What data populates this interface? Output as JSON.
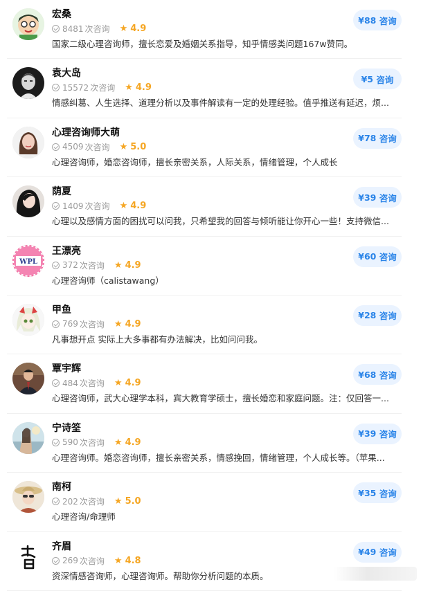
{
  "consult_label": "咨询",
  "count_unit": "次咨询",
  "experts": [
    {
      "name": "宏桑",
      "count": "8481",
      "rating": "4.9",
      "desc": "国家二级心理咨询师，擅长恋爱及婚姻关系指导，知乎情感类问题167w赞同。",
      "price": "¥88",
      "avatar": "cartoon-boy-avatar"
    },
    {
      "name": "袁大岛",
      "count": "15572",
      "rating": "4.9",
      "desc": "情感纠葛、人生选择、道理分析以及事件解读有一定的处理经验。值乎推送有延迟，烦...",
      "price": "¥5",
      "avatar": "portrait-man-avatar"
    },
    {
      "name": "心理咨询师大萌",
      "count": "4509",
      "rating": "5.0",
      "desc": "心理咨询师，婚恋咨询师，擅长亲密关系，人际关系，情绪管理，个人成长",
      "price": "¥78",
      "avatar": "woman-photo-avatar"
    },
    {
      "name": "荫夏",
      "count": "1409",
      "rating": "4.9",
      "desc": "心理以及感情方面的困扰可以问我，只希望我的回答与倾听能让你开心一些！支持微信...",
      "price": "¥39",
      "avatar": "woman-dark-hair-avatar"
    },
    {
      "name": "王漂亮",
      "count": "372",
      "rating": "4.9",
      "desc": "心理咨询师（calistawang）",
      "price": "¥60",
      "avatar": "wpl-logo-avatar"
    },
    {
      "name": "甲鱼",
      "count": "769",
      "rating": "4.9",
      "desc": "凡事想开点 实际上大多事都有办法解决，比如问问我。",
      "price": "¥28",
      "avatar": "anime-girl-avatar"
    },
    {
      "name": "覃宇辉",
      "count": "484",
      "rating": "4.9",
      "desc": "心理咨询师，武大心理学本科，宾大教育学硕士，擅长婚恋和家庭问题。注：仅回答一...",
      "price": "¥68",
      "avatar": "man-suit-avatar"
    },
    {
      "name": "宁诗筌",
      "count": "590",
      "rating": "4.9",
      "desc": "心理咨询师。婚恋咨询师，擅长亲密关系，情感挽回，情绪管理，个人成长等。（苹果...",
      "price": "¥39",
      "avatar": "painting-avatar"
    },
    {
      "name": "南柯",
      "count": "202",
      "rating": "5.0",
      "desc": "心理咨询/命理师",
      "price": "¥35",
      "avatar": "woman-hat-avatar"
    },
    {
      "name": "齐眉",
      "count": "269",
      "rating": "4.8",
      "desc": "资深情感咨询师，心理咨询师。帮助你分析问题的本质。",
      "price": "¥49",
      "avatar": "calligraphy-avatar"
    }
  ],
  "colors": {
    "accent": "#2a84e8",
    "button_bg": "#eaf3ff",
    "star": "#f5a623",
    "muted": "#9a9a9a"
  }
}
